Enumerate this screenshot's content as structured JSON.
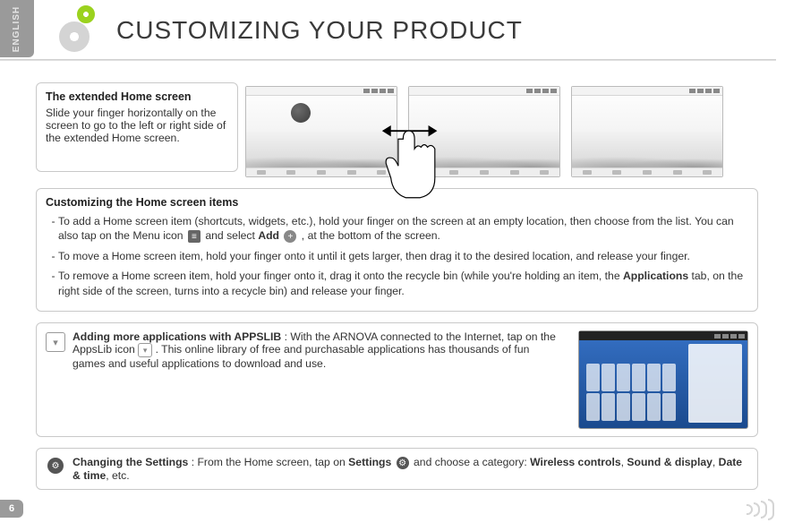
{
  "lang_tab": "ENGLISH",
  "title": "CUSTOMIZING YOUR PRODUCT",
  "page_number": "6",
  "intro": {
    "heading": "The extended Home screen",
    "body": "Slide your finger horizontally on the screen to go to the left or right side of the extended Home screen."
  },
  "customizing": {
    "heading": "Customizing the Home screen items",
    "items": {
      "a": {
        "t1": "To add a Home screen item (shortcuts, widgets, etc.), hold your finger on the screen at an empty location, then choose from the list. You can also tap on the Menu icon ",
        "t2": " and select ",
        "bold1": "Add",
        "t3": " ",
        "t4": ", at the bottom of the screen."
      },
      "b": "To move a Home screen item, hold your finger onto it until it gets larger, then drag it to the desired location, and release your finger.",
      "c": {
        "t1": "To remove a Home screen item, hold your finger onto it, drag it onto the recycle bin (while you're holding an item, the ",
        "bold1": "Applications",
        "t2": " tab, on the right side of the screen, turns into a recycle bin) and release your finger."
      }
    }
  },
  "appslib": {
    "bold": "Adding more applications with APPSLIB",
    "t1": " : With the ARNOVA connected to the Internet, tap on the AppsLib icon ",
    "t2": ". This online library of free and purchasable applications has thousands of fun games and useful applications to download and use."
  },
  "settings": {
    "bold1": "Changing the Settings",
    "t1": ": From the Home screen, tap on ",
    "bold2": "Settings",
    "t2": " and choose a category: ",
    "bold3": "Wireless controls",
    "bold4": "Sound & display",
    "bold5": "Date & time",
    "t3": ", etc."
  }
}
